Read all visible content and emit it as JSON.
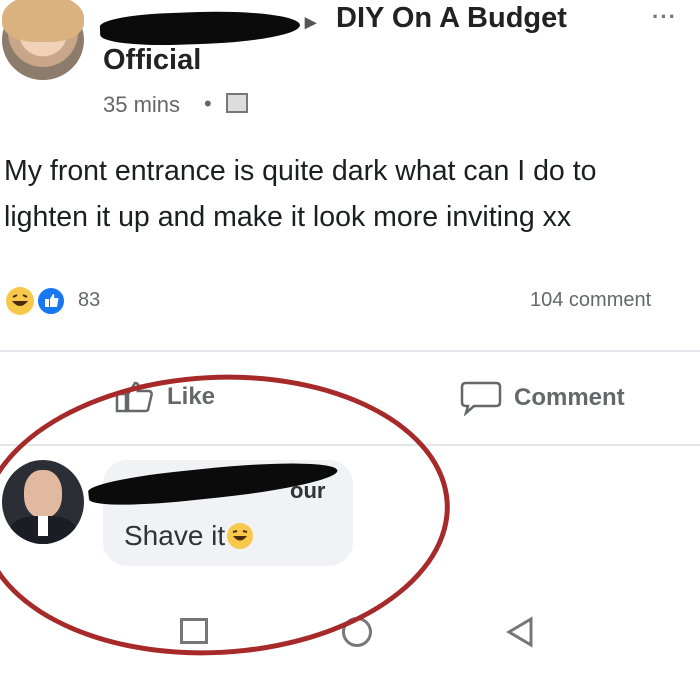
{
  "post": {
    "group_arrow": "▸",
    "group_name": "DIY On A Budget",
    "author_suffix": "Official",
    "time": "35 mins",
    "dot": "•",
    "text_line1": "My front entrance is quite dark what can I do to",
    "text_line2": "lighten it up and make it look more inviting xx",
    "reaction_count": "83",
    "comment_count": "104 comment",
    "more_glyph": "···"
  },
  "actions": {
    "like": "Like",
    "comment": "Comment"
  },
  "comment": {
    "name_tail": "our",
    "text": "Shave it"
  },
  "colors": {
    "like_blue": "#1877f2",
    "annotation_red": "#a72a2a"
  },
  "icons": [
    "like-icon",
    "comment-icon",
    "haha-reaction-icon",
    "like-reaction-icon",
    "globe-icon",
    "more-icon",
    "square-nav-icon",
    "home-nav-icon",
    "back-nav-icon"
  ]
}
